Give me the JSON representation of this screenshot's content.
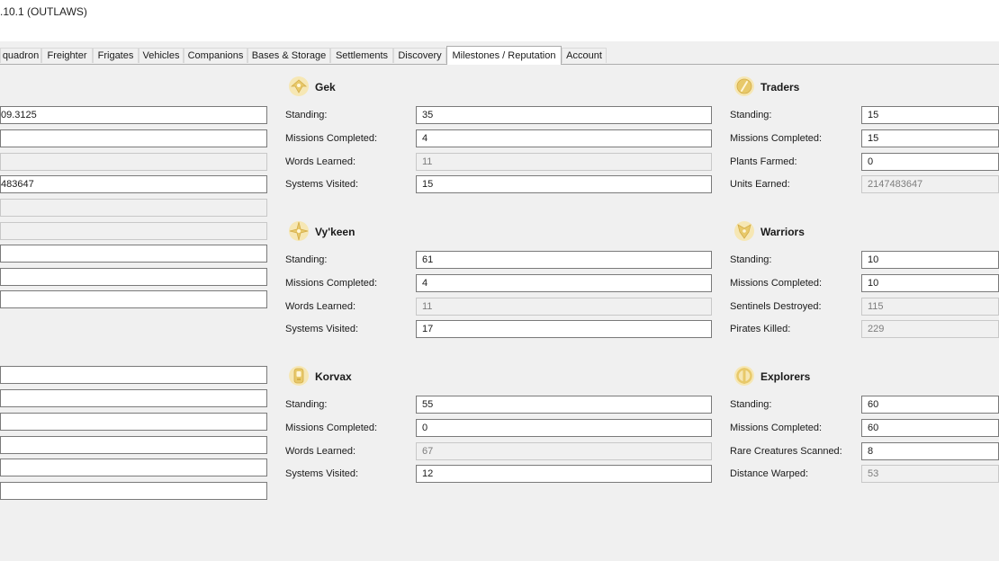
{
  "window": {
    "title": ".10.1 (OUTLAWS)"
  },
  "tabs": [
    {
      "label": "quadron"
    },
    {
      "label": "Freighter"
    },
    {
      "label": "Frigates"
    },
    {
      "label": "Vehicles"
    },
    {
      "label": "Companions"
    },
    {
      "label": "Bases & Storage"
    },
    {
      "label": "Settlements"
    },
    {
      "label": "Discovery"
    },
    {
      "label": "Milestones / Reputation",
      "active": true
    },
    {
      "label": "Account"
    }
  ],
  "left_fields": [
    "09.3125",
    "",
    "",
    "483647",
    "",
    "",
    "",
    "",
    "",
    "",
    "",
    "",
    "",
    "",
    ""
  ],
  "groups": {
    "gek": {
      "title": "Gek",
      "icon": "gek-emblem-icon",
      "rows": [
        {
          "label": "Standing:",
          "value": "35"
        },
        {
          "label": "Missions Completed:",
          "value": "4"
        },
        {
          "label": "Words Learned:",
          "value": "11"
        },
        {
          "label": "Systems Visited:",
          "value": "15"
        }
      ]
    },
    "vykeen": {
      "title": "Vy'keen",
      "icon": "vykeen-emblem-icon",
      "rows": [
        {
          "label": "Standing:",
          "value": "61"
        },
        {
          "label": "Missions Completed:",
          "value": "4"
        },
        {
          "label": "Words Learned:",
          "value": "11"
        },
        {
          "label": "Systems Visited:",
          "value": "17"
        }
      ]
    },
    "korvax": {
      "title": "Korvax",
      "icon": "korvax-emblem-icon",
      "rows": [
        {
          "label": "Standing:",
          "value": "55"
        },
        {
          "label": "Missions Completed:",
          "value": "0"
        },
        {
          "label": "Words Learned:",
          "value": "67"
        },
        {
          "label": "Systems Visited:",
          "value": "12"
        }
      ]
    },
    "traders": {
      "title": "Traders",
      "icon": "traders-emblem-icon",
      "rows": [
        {
          "label": "Standing:",
          "value": "15"
        },
        {
          "label": "Missions Completed:",
          "value": "15"
        },
        {
          "label": "Plants Farmed:",
          "value": "0"
        },
        {
          "label": "Units Earned:",
          "value": "2147483647"
        }
      ]
    },
    "warriors": {
      "title": "Warriors",
      "icon": "warriors-emblem-icon",
      "rows": [
        {
          "label": "Standing:",
          "value": "10"
        },
        {
          "label": "Missions Completed:",
          "value": "10"
        },
        {
          "label": "Sentinels Destroyed:",
          "value": "115"
        },
        {
          "label": "Pirates Killed:",
          "value": "229"
        }
      ]
    },
    "explorers": {
      "title": "Explorers",
      "icon": "explorers-emblem-icon",
      "rows": [
        {
          "label": "Standing:",
          "value": "60"
        },
        {
          "label": "Missions Completed:",
          "value": "60"
        },
        {
          "label": "Rare Creatures Scanned:",
          "value": "8"
        },
        {
          "label": "Distance Warped:",
          "value": "53"
        }
      ]
    }
  },
  "colors": {
    "emblem_gold": "#e8c96a",
    "emblem_light": "#f6e7b4",
    "background": "#f0f0f0",
    "field_border": "#7a7a7a"
  }
}
